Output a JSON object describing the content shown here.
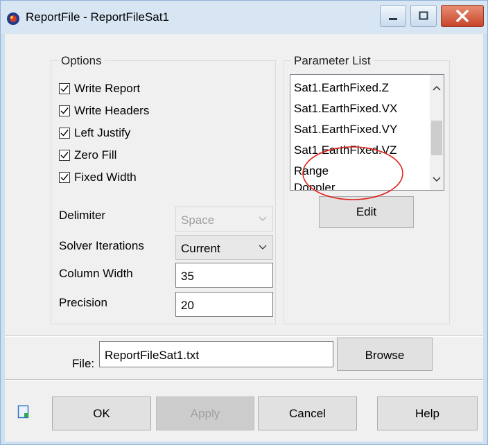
{
  "window": {
    "title": "ReportFile - ReportFileSat1",
    "controls": [
      "minimize-icon",
      "maximize-icon",
      "close-icon"
    ]
  },
  "options": {
    "group_title": "Options",
    "checkboxes": [
      {
        "label": "Write Report",
        "checked": true
      },
      {
        "label": "Write Headers",
        "checked": true
      },
      {
        "label": "Left Justify",
        "checked": true
      },
      {
        "label": "Zero Fill",
        "checked": true
      },
      {
        "label": "Fixed Width",
        "checked": true
      }
    ],
    "delimiter": {
      "label": "Delimiter",
      "value": "Space",
      "enabled": false
    },
    "solver_iterations": {
      "label": "Solver Iterations",
      "value": "Current"
    },
    "column_width": {
      "label": "Column Width",
      "value": "35"
    },
    "precision": {
      "label": "Precision",
      "value": "20"
    }
  },
  "parameters": {
    "group_title": "Parameter List",
    "items": [
      "Sat1.EarthFixed.Z",
      "Sat1.EarthFixed.VX",
      "Sat1.EarthFixed.VY",
      "Sat1.EarthFixed.VZ",
      "Range",
      "Doppler"
    ],
    "edit_label": "Edit"
  },
  "file": {
    "label": "File:",
    "value": "ReportFileSat1.txt",
    "browse_label": "Browse"
  },
  "footer": {
    "ok_label": "OK",
    "apply_label": "Apply",
    "apply_enabled": false,
    "cancel_label": "Cancel",
    "help_label": "Help"
  },
  "colors": {
    "title_bg": "#d8e6f4",
    "close_button": "#c7442a",
    "annotation_circle": "#e0241b"
  }
}
